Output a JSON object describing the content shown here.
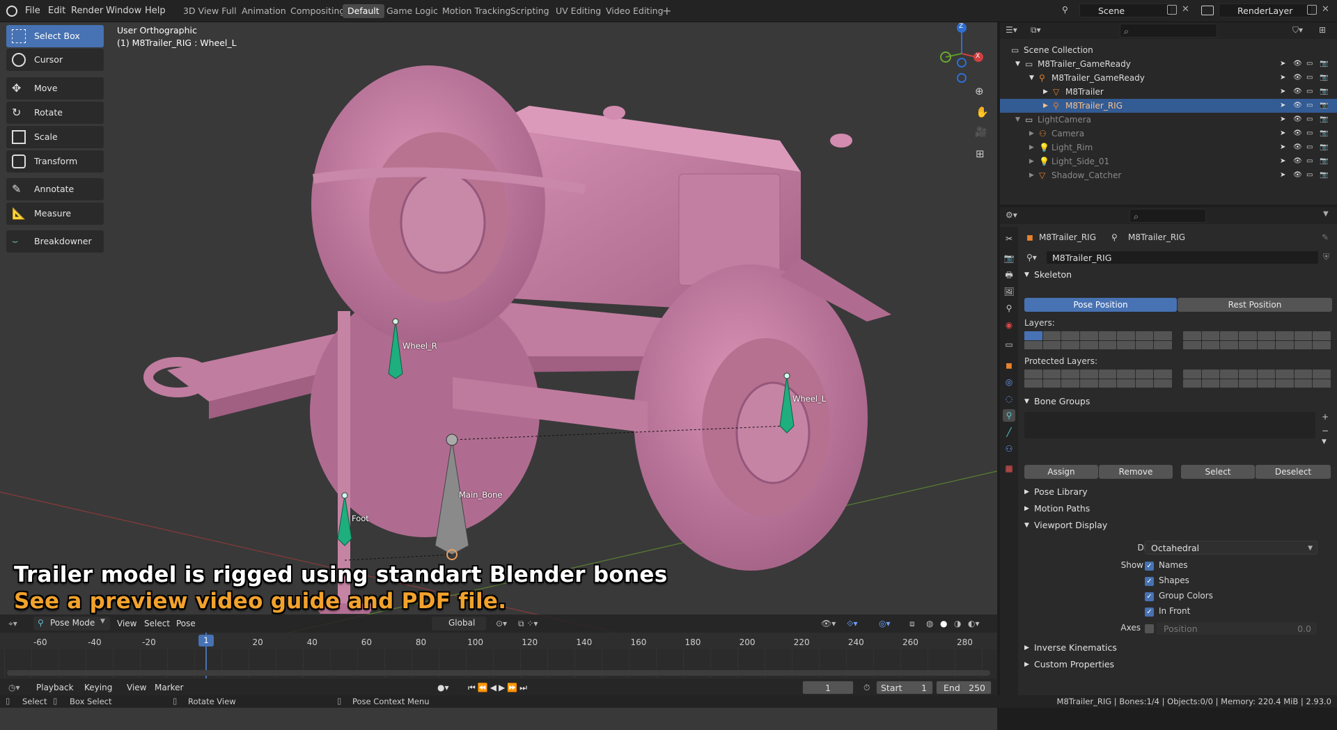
{
  "menu": [
    "File",
    "Edit",
    "Render",
    "Window",
    "Help"
  ],
  "workspaces": [
    "3D View Full",
    "Animation",
    "Compositing",
    "Default",
    "Game Logic",
    "Motion Tracking",
    "Scripting",
    "UV Editing",
    "Video Editing"
  ],
  "active_workspace": "Default",
  "scene_field": "Scene",
  "view_layer_field": "RenderLayer",
  "tools": [
    "Select Box",
    "Cursor",
    "Move",
    "Rotate",
    "Scale",
    "Transform",
    "Annotate",
    "Measure",
    "Breakdowner"
  ],
  "viewport": {
    "view_name": "User Orthographic",
    "object_info": "(1) M8Trailer_RIG : Wheel_L",
    "bones": {
      "wheel_r": "Wheel_R",
      "wheel_l": "Wheel_L",
      "main": "Main_Bone",
      "foot": "Foot"
    },
    "caption_line1": "Trailer model is rigged using standart Blender bones",
    "caption_line2": "See a preview video guide and PDF file.",
    "header": {
      "mode": "Pose Mode",
      "view": "View",
      "select": "Select",
      "pose": "Pose",
      "orientation": "Global"
    },
    "gizmo": {
      "z": "Z",
      "y": "Y",
      "x": "X"
    }
  },
  "timeline": {
    "ticks": [
      "-60",
      "-40",
      "-20",
      "20",
      "40",
      "60",
      "80",
      "100",
      "120",
      "140",
      "160",
      "180",
      "200",
      "220",
      "240",
      "260",
      "280"
    ],
    "current_frame": "1",
    "playback": "Playback",
    "keying": "Keying",
    "view": "View",
    "marker": "Marker",
    "frame_field": "1",
    "start_label": "Start",
    "start": "1",
    "end_label": "End",
    "end": "250"
  },
  "outliner": {
    "rows": [
      {
        "name": "Scene Collection",
        "indent": 0
      },
      {
        "name": "M8Trailer_GameReady",
        "indent": 1
      },
      {
        "name": "M8Trailer_GameReady",
        "indent": 2
      },
      {
        "name": "M8Trailer",
        "indent": 3
      },
      {
        "name": "M8Trailer_RIG",
        "indent": 3
      },
      {
        "name": "LightCamera",
        "indent": 1
      },
      {
        "name": "Camera",
        "indent": 2
      },
      {
        "name": "Light_Rim",
        "indent": 2
      },
      {
        "name": "Light_Side_01",
        "indent": 2
      },
      {
        "name": "Shadow_Catcher",
        "indent": 2
      }
    ]
  },
  "properties": {
    "breadcrumb_obj": "M8Trailer_RIG",
    "breadcrumb_data": "M8Trailer_RIG",
    "data_name": "M8Trailer_RIG",
    "skeleton": "Skeleton",
    "pose_position": "Pose Position",
    "rest_position": "Rest Position",
    "layers": "Layers:",
    "protected_layers": "Protected Layers:",
    "bone_groups": "Bone Groups",
    "assign": "Assign",
    "remove": "Remove",
    "select": "Select",
    "deselect": "Deselect",
    "pose_library": "Pose Library",
    "motion_paths": "Motion Paths",
    "viewport_display": "Viewport Display",
    "display_as_label": "Display As",
    "display_as": "Octahedral",
    "show_label": "Show",
    "names": "Names",
    "shapes": "Shapes",
    "group_colors": "Group Colors",
    "in_front": "In Front",
    "axes_label": "Axes",
    "position": "Position",
    "position_value": "0.0",
    "inverse_kinematics": "Inverse Kinematics",
    "custom_properties": "Custom Properties"
  },
  "status": {
    "select": "Select",
    "box_select": "Box Select",
    "rotate_view": "Rotate View",
    "pose_context": "Pose Context Menu",
    "info": "M8Trailer_RIG | Bones:1/4 | Objects:0/0 | Memory: 220.4 MiB | 2.93.0"
  },
  "colors": {
    "accent": "#4772b3",
    "mesh": "#c97fa3",
    "bone": "#1fae7e",
    "viewport_bg": "#393939",
    "caption2": "#f2a22c"
  }
}
